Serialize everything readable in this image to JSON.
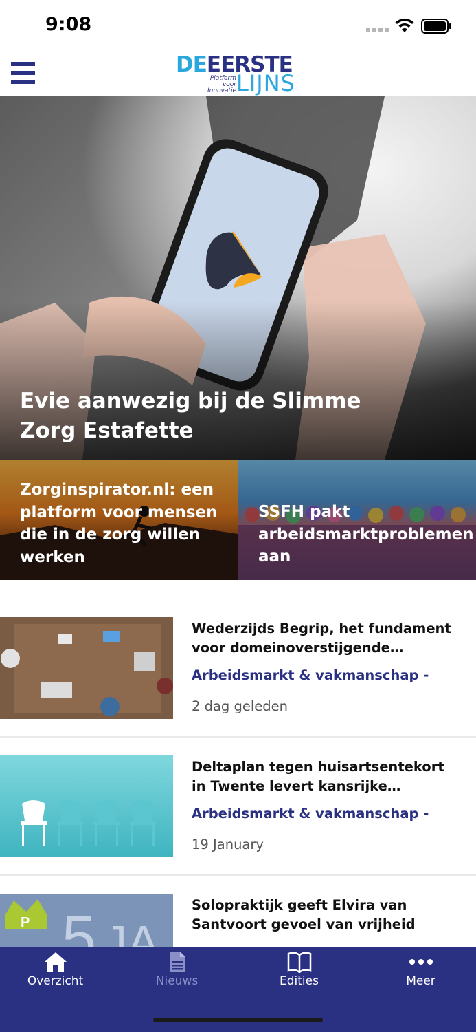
{
  "status_bar": {
    "time": "9:08"
  },
  "header": {
    "logo": {
      "line1_a": "DE",
      "line1_b": "EERSTE",
      "sub": "Platform voor Innovatie",
      "line2": "LIJNS"
    }
  },
  "hero": {
    "title": "Evie aanwezig bij de Slimme Zorg Estafette"
  },
  "tiles": [
    {
      "title": "Zorginspirator.nl: een platform voor mensen die in de zorg willen werken"
    },
    {
      "title": "SSFH pakt arbeidsmarktproblemen aan"
    }
  ],
  "news": [
    {
      "title": "Wederzijds Begrip, het fundament voor domeinoverstijgende samenwerking",
      "category": "Arbeidsmarkt & vakmanschap -",
      "date": "2 dag geleden"
    },
    {
      "title": "Deltaplan tegen huisartsentekort in Twente levert kansrijke resultaten op",
      "category": "Arbeidsmarkt & vakmanschap -",
      "date": "19 January"
    },
    {
      "title": "Solopraktijk geeft Elvira van Santvoort gevoel van vrijheid",
      "category": "",
      "date": ""
    }
  ],
  "tabbar": {
    "tabs": [
      {
        "label": "Overzicht",
        "icon": "home-icon",
        "active": true
      },
      {
        "label": "Nieuws",
        "icon": "document-icon",
        "active": false
      },
      {
        "label": "Edities",
        "icon": "book-icon",
        "active": true
      },
      {
        "label": "Meer",
        "icon": "more-icon",
        "active": true
      }
    ]
  },
  "colors": {
    "brand_navy": "#2a3082",
    "brand_cyan": "#2aa7dd"
  }
}
